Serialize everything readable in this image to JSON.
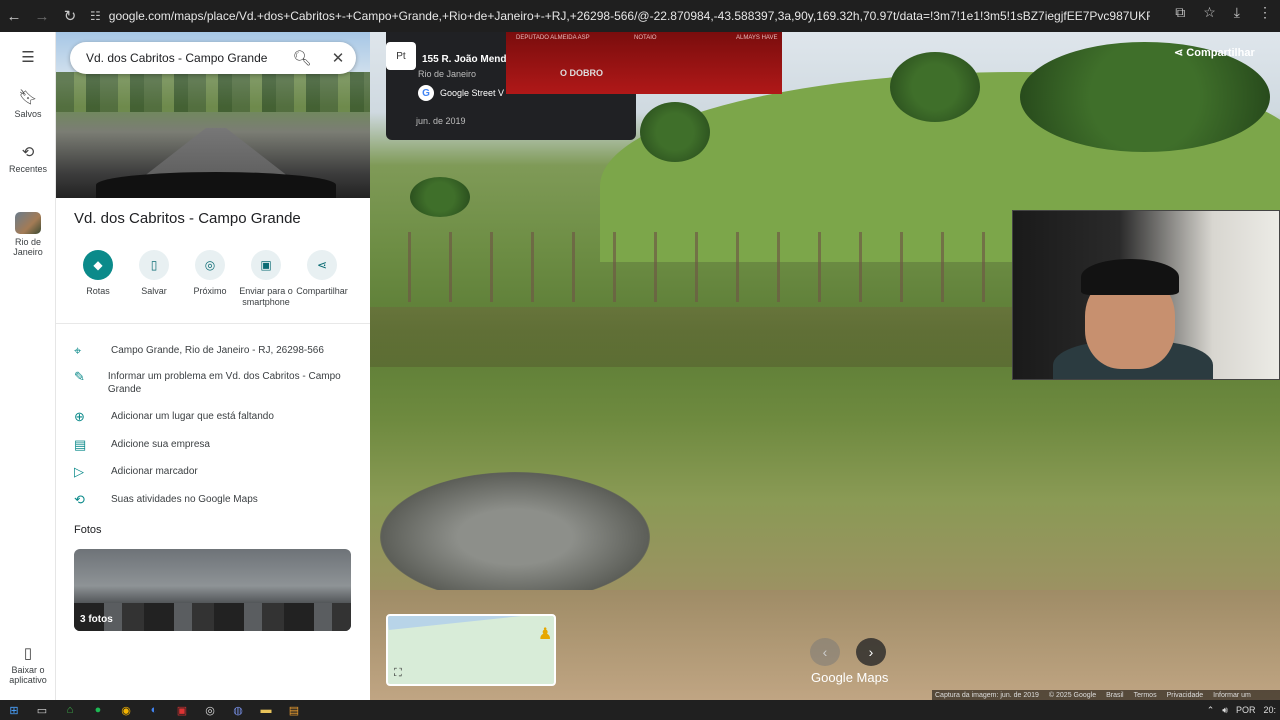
{
  "browser": {
    "url": "google.com/maps/place/Vd.+dos+Cabritos+-+Campo+Grande,+Rio+de+Janeiro+-+RJ,+26298-566/@-22.870984,-43.588397,3a,90y,169.32h,70.97t/data=!3m7!1e1!3m5!1sBZ7iegjfEE7Pvc987UKFQQ!2e0!6shttps:%2...",
    "icons": [
      "back-icon",
      "forward-icon",
      "reload-icon",
      "site-info-icon",
      "install-icon",
      "star-icon",
      "download-icon",
      "menu-icon"
    ]
  },
  "rail": {
    "saved": "Salvos",
    "recent": "Recentes",
    "place": "Rio de Janeiro",
    "app": "Baixar o aplicativo"
  },
  "search": {
    "value": "Vd. dos Cabritos - Campo Grande"
  },
  "place": {
    "title": "Vd. dos Cabritos - Campo Grande",
    "actions": [
      {
        "label": "Rotas",
        "icon": "directions-icon"
      },
      {
        "label": "Salvar",
        "icon": "bookmark-icon"
      },
      {
        "label": "Próximo",
        "icon": "nearby-icon"
      },
      {
        "label": "Enviar para o smartphone",
        "icon": "phone-icon"
      },
      {
        "label": "Compartilhar",
        "icon": "share-icon"
      }
    ],
    "info": [
      {
        "text": "Campo Grande, Rio de Janeiro - RJ, 26298-566",
        "icon": "pin-icon"
      },
      {
        "text": "Informar um problema em Vd. dos Cabritos - Campo Grande",
        "icon": "pencil-icon"
      },
      {
        "text": "Adicionar um lugar que está faltando",
        "icon": "add-place-icon"
      },
      {
        "text": "Adicione sua empresa",
        "icon": "store-icon"
      },
      {
        "text": "Adicionar marcador",
        "icon": "label-icon"
      },
      {
        "text": "Suas atividades no Google Maps",
        "icon": "history-icon"
      }
    ],
    "photos_heading": "Fotos",
    "photos_count": "3 fotos"
  },
  "streetview": {
    "address": "155 R. João Mend",
    "city": "Rio de Janeiro",
    "source": "Google Street V",
    "date": "jun. de 2019",
    "share": "Compartilhar",
    "logo": "Google Maps",
    "footer": [
      "Captura da imagem: jun. de 2019",
      "© 2025 Google",
      "Brasil",
      "Termos",
      "Privacidade",
      "Informar um"
    ],
    "lang_btn": "Pt"
  },
  "overlay_banner": {
    "labels": [
      "DEPUTADO ALMEIDA ASP",
      "NOTAIO",
      "ALMAYS HAVE"
    ],
    "brand": "O DOBRO"
  },
  "taskbar": {
    "lang": "POR",
    "time": "20:"
  }
}
